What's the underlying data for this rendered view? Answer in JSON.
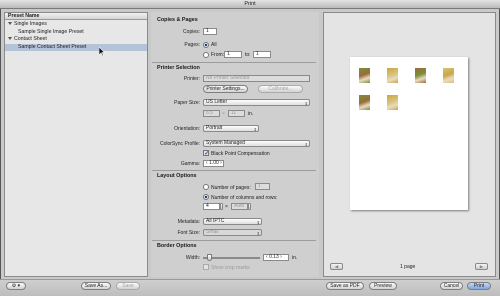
{
  "window": {
    "title": "Print"
  },
  "presets": {
    "header": "Preset Name",
    "groups": [
      {
        "label": "Single Images",
        "items": [
          "Sample Single Image Preset"
        ]
      },
      {
        "label": "Contact Sheet",
        "items": [
          "Sample Contact Sheet Preset"
        ]
      }
    ]
  },
  "copies_pages": {
    "title": "Copies & Pages",
    "copies_label": "Copies:",
    "copies_value": "1",
    "pages_label": "Pages:",
    "all_label": "All",
    "from_label": "From:",
    "from_value": "1",
    "to_label": "to:",
    "to_value": "1"
  },
  "printer_selection": {
    "title": "Printer Selection",
    "printer_label": "Printer:",
    "printer_value": "No Printer Selected",
    "printer_settings_button": "Printer Settings...",
    "calibrate_button": "Calibrate...",
    "paper_size_label": "Paper Size:",
    "paper_size_value": "US Letter",
    "width_value": "8.5",
    "height_value": "11",
    "units": "in.",
    "orientation_label": "Orientation:",
    "orientation_value": "Portrait",
    "colorsync_label": "ColorSync Profile:",
    "colorsync_value": "System Managed",
    "bpc_label": "Black Point Compensation",
    "gamma_label": "Gamma:",
    "gamma_value": "1.00"
  },
  "layout_options": {
    "title": "Layout Options",
    "num_pages_label": "Number of pages:",
    "num_pages_value": "1",
    "cols_rows_label": "Number of columns and rows:",
    "cols_value": "4",
    "times": "×",
    "rows_value": "Auto",
    "metadata_label": "Metadata:",
    "metadata_value": "All IPTC",
    "font_size_label": "Font Size:",
    "font_size_value": "Small"
  },
  "border_options": {
    "title": "Border Options",
    "width_label": "Width:",
    "width_value": "0.13",
    "units": "in.",
    "crop_marks_label": "Show crop marks"
  },
  "preview": {
    "page_count": "1 page",
    "thumbnails_count": 6
  },
  "bottom_bar": {
    "gear_label": "⚙",
    "save_as_button": "Save As...",
    "save_button": "Save",
    "save_as_pdf_button": "Save as PDF",
    "preview_button": "Preview",
    "cancel_button": "Cancel",
    "print_button": "Print"
  },
  "colors": {
    "window_bg": "#c9c9c9",
    "selection": "#b5c3d8",
    "paper": "#ffffff"
  }
}
